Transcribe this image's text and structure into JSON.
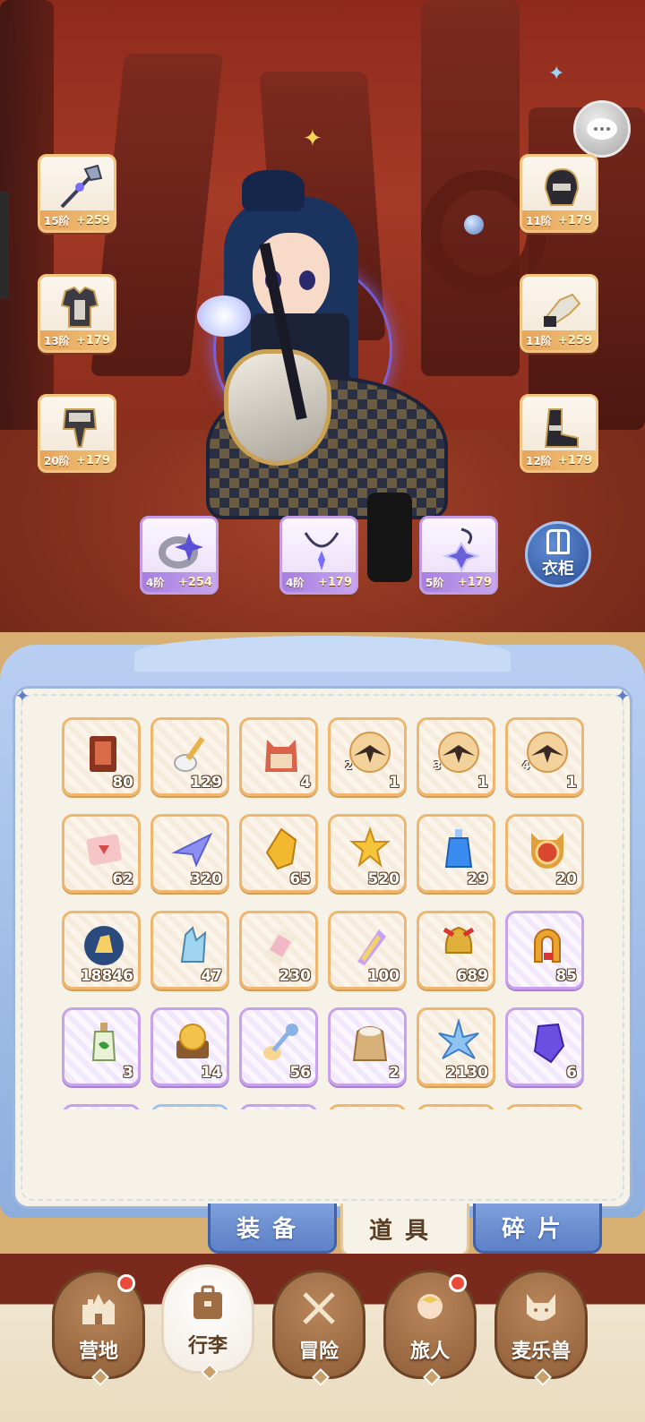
{
  "scene": {
    "chat_icon": "chat-bubble-icon"
  },
  "equipment": {
    "weapon": {
      "tier": "15阶",
      "bonus": "+259",
      "icon": "halberd-icon"
    },
    "chest": {
      "tier": "13阶",
      "bonus": "+179",
      "icon": "chest-armor-icon"
    },
    "legs": {
      "tier": "20阶",
      "bonus": "+179",
      "icon": "leg-armor-icon"
    },
    "helmet": {
      "tier": "11阶",
      "bonus": "+179",
      "icon": "helmet-icon"
    },
    "gloves": {
      "tier": "11阶",
      "bonus": "+259",
      "icon": "gauntlet-icon"
    },
    "boots": {
      "tier": "12阶",
      "bonus": "+179",
      "icon": "boots-icon"
    },
    "ring": {
      "tier": "4阶",
      "bonus": "+254",
      "icon": "ring-icon"
    },
    "necklace": {
      "tier": "4阶",
      "bonus": "+179",
      "icon": "necklace-icon"
    },
    "charm": {
      "tier": "5阶",
      "bonus": "+179",
      "icon": "charm-icon"
    }
  },
  "wardrobe": {
    "label": "衣柜"
  },
  "inventory": {
    "rows": [
      [
        {
          "icon": "ticket-icon",
          "count": "80",
          "rarity": "gold"
        },
        {
          "icon": "spoon-icon",
          "count": "129",
          "rarity": "gold"
        },
        {
          "icon": "cat-bag-icon",
          "count": "4",
          "rarity": "gold"
        },
        {
          "icon": "wing-shard-icon",
          "count": "1",
          "level": "2",
          "rarity": "gold"
        },
        {
          "icon": "wing-shard-icon",
          "count": "1",
          "level": "3",
          "rarity": "gold"
        },
        {
          "icon": "wing-shard-icon",
          "count": "1",
          "level": "4",
          "rarity": "gold"
        }
      ],
      [
        {
          "icon": "scroll-icon",
          "count": "62",
          "rarity": "gold"
        },
        {
          "icon": "paper-plane-icon",
          "count": "320",
          "rarity": "gold"
        },
        {
          "icon": "gold-gem-icon",
          "count": "65",
          "rarity": "gold"
        },
        {
          "icon": "star-shard-icon",
          "count": "520",
          "rarity": "gold"
        },
        {
          "icon": "potion-icon",
          "count": "29",
          "rarity": "gold"
        },
        {
          "icon": "cat-coin-icon",
          "count": "20",
          "rarity": "gold"
        }
      ],
      [
        {
          "icon": "crystal-orb-icon",
          "count": "18846",
          "rarity": "gold"
        },
        {
          "icon": "ice-crystal-icon",
          "count": "47",
          "rarity": "gold"
        },
        {
          "icon": "paint-tube-icon",
          "count": "230",
          "rarity": "gold"
        },
        {
          "icon": "rainbow-paint-icon",
          "count": "100",
          "rarity": "gold"
        },
        {
          "icon": "bell-icon",
          "count": "689",
          "rarity": "gold"
        },
        {
          "icon": "horseshoe-icon",
          "count": "85",
          "rarity": "purple"
        }
      ],
      [
        {
          "icon": "bottle-icon",
          "count": "3",
          "rarity": "purple"
        },
        {
          "icon": "toast-icon",
          "count": "14",
          "rarity": "purple"
        },
        {
          "icon": "cat-spoon-icon",
          "count": "56",
          "rarity": "purple"
        },
        {
          "icon": "flour-sack-icon",
          "count": "2",
          "rarity": "purple"
        },
        {
          "icon": "blue-star-icon",
          "count": "2130",
          "rarity": "gold"
        },
        {
          "icon": "purple-gem-icon",
          "count": "6",
          "rarity": "purple"
        }
      ],
      [
        {
          "icon": "egg-icon",
          "count": "",
          "rarity": "purple"
        },
        {
          "icon": "bow-icon",
          "count": "",
          "rarity": "blue"
        },
        {
          "icon": "disc-icon",
          "count": "",
          "rarity": "purple"
        },
        {
          "icon": "gem-icon",
          "count": "",
          "rarity": "gold"
        },
        {
          "icon": "red-gem-icon",
          "count": "",
          "rarity": "gold"
        },
        {
          "icon": "red-gem-icon",
          "count": "",
          "rarity": "gold"
        }
      ]
    ]
  },
  "tabs": [
    {
      "label": "装备",
      "active": false
    },
    {
      "label": "道具",
      "active": true
    },
    {
      "label": "碎片",
      "active": false
    }
  ],
  "nav": [
    {
      "label": "营地",
      "icon": "castle-icon",
      "badge": true,
      "active": false
    },
    {
      "label": "行李",
      "icon": "luggage-icon",
      "badge": false,
      "active": true
    },
    {
      "label": "冒险",
      "icon": "crossed-swords-icon",
      "badge": false,
      "active": false
    },
    {
      "label": "旅人",
      "icon": "traveler-icon",
      "badge": true,
      "active": false
    },
    {
      "label": "麦乐兽",
      "icon": "cat-pet-icon",
      "badge": false,
      "active": false
    }
  ]
}
